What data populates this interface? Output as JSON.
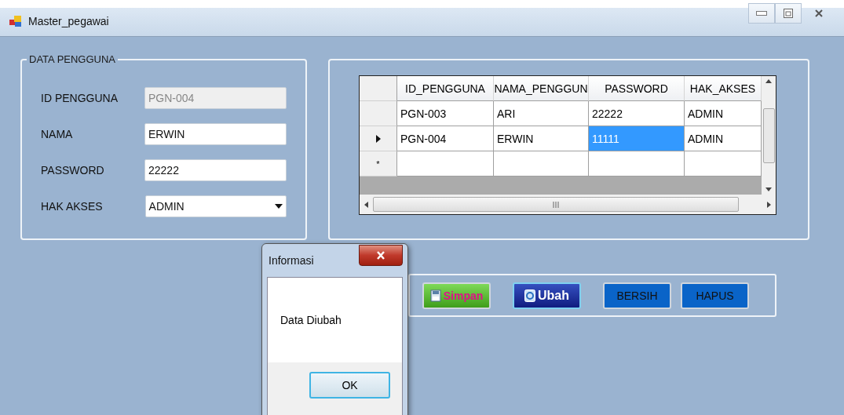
{
  "window": {
    "title": "Master_pegawai"
  },
  "form": {
    "title": "DATA PENGGUNA",
    "fields": [
      {
        "label": "ID PENGGUNA",
        "value": "PGN-004",
        "kind": "text",
        "disabled": true
      },
      {
        "label": "NAMA",
        "value": "ERWIN",
        "kind": "text",
        "disabled": false
      },
      {
        "label": "PASSWORD",
        "value": "22222",
        "kind": "text",
        "disabled": false
      },
      {
        "label": "HAK AKSES",
        "value": "ADMIN",
        "kind": "dropdown",
        "disabled": false
      }
    ]
  },
  "table": {
    "columns": [
      "ID_PENGGUNA",
      "NAMA_PENGGUN",
      "PASSWORD",
      "HAK_AKSES"
    ],
    "rows": [
      {
        "current": false,
        "cells": [
          {
            "text": "PGN-003",
            "selected": false
          },
          {
            "text": "ARI",
            "selected": false
          },
          {
            "text": "22222",
            "selected": false
          },
          {
            "text": "ADMIN",
            "selected": false
          }
        ]
      },
      {
        "current": true,
        "cells": [
          {
            "text": "PGN-004",
            "selected": false
          },
          {
            "text": "ERWIN",
            "selected": false
          },
          {
            "text": "11111",
            "selected": true
          },
          {
            "text": "ADMIN",
            "selected": false
          }
        ]
      }
    ],
    "new_row_marker": "*"
  },
  "buttons": [
    {
      "label": "Simpan",
      "kind": "save"
    },
    {
      "label": "Ubah",
      "kind": "edit"
    },
    {
      "label": "BERSIH",
      "kind": "plain"
    },
    {
      "label": "HAPUS",
      "kind": "plain"
    }
  ],
  "dialog": {
    "title": "Informasi",
    "message": "Data Diubah",
    "button": "OK"
  }
}
